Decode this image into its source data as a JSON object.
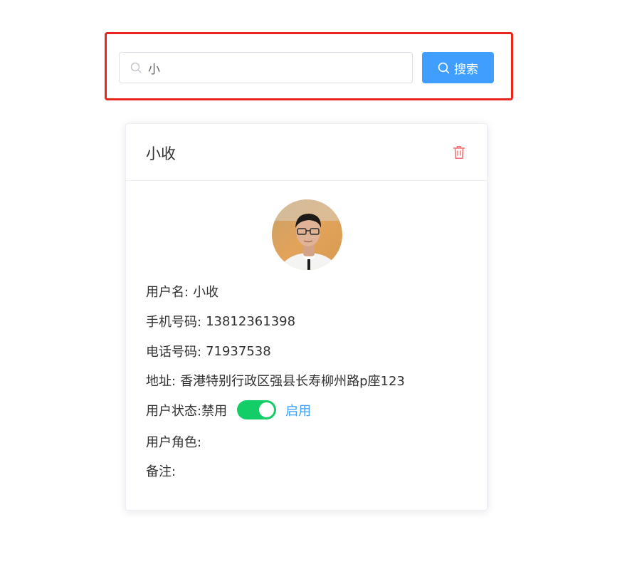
{
  "search": {
    "value": "小",
    "button_label": "搜索",
    "prefix_icon": "search-icon"
  },
  "card": {
    "title": "小收",
    "delete_icon": "trash-icon",
    "fields": {
      "username_label": "用户名:",
      "username_value": "小收",
      "mobile_label": "手机号码:",
      "mobile_value": "13812361398",
      "phone_label": "电话号码:",
      "phone_value": "71937538",
      "address_label": "地址:",
      "address_value": "香港特别行政区强县长寿柳州路p座123",
      "status_label": "用户状态:",
      "status_off_text": "禁用",
      "status_on_text": "启用",
      "status_enabled": true,
      "role_label": "用户角色:",
      "remark_label": "备注:"
    }
  },
  "colors": {
    "primary": "#409eff",
    "switch_on": "#13ce66",
    "danger": "#f56c6c",
    "highlight": "#e8261d"
  }
}
